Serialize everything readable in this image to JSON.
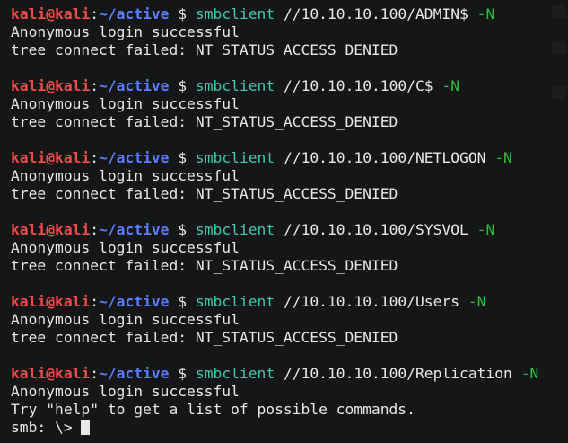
{
  "prompt": {
    "user": "kali",
    "at": "@",
    "host": "kali",
    "colon": ":",
    "path": "~/active",
    "dollar": "$"
  },
  "blocks": [
    {
      "cmd": "smbclient",
      "arg": "//10.10.10.100/ADMIN$",
      "flag": "-N",
      "output": [
        "Anonymous login successful",
        "tree connect failed: NT_STATUS_ACCESS_DENIED"
      ]
    },
    {
      "cmd": "smbclient",
      "arg": "//10.10.10.100/C$",
      "flag": "-N",
      "output": [
        "Anonymous login successful",
        "tree connect failed: NT_STATUS_ACCESS_DENIED"
      ]
    },
    {
      "cmd": "smbclient",
      "arg": "//10.10.10.100/NETLOGON",
      "flag": "-N",
      "output": [
        "Anonymous login successful",
        "tree connect failed: NT_STATUS_ACCESS_DENIED"
      ]
    },
    {
      "cmd": "smbclient",
      "arg": "//10.10.10.100/SYSVOL",
      "flag": "-N",
      "output": [
        "Anonymous login successful",
        "tree connect failed: NT_STATUS_ACCESS_DENIED"
      ]
    },
    {
      "cmd": "smbclient",
      "arg": "//10.10.10.100/Users",
      "flag": "-N",
      "output": [
        "Anonymous login successful",
        "tree connect failed: NT_STATUS_ACCESS_DENIED"
      ]
    },
    {
      "cmd": "smbclient",
      "arg": "//10.10.10.100/Replication",
      "flag": "-N",
      "output": [
        "Anonymous login successful",
        "Try \"help\" to get a list of possible commands."
      ]
    }
  ],
  "smb_prompt": "smb: \\> ",
  "colors": {
    "background": "#151617",
    "user": "#ee4b4b",
    "path": "#5a7dff",
    "command": "#3fc8ae",
    "flag": "#2fbf3f",
    "text": "#e8e8e8"
  }
}
